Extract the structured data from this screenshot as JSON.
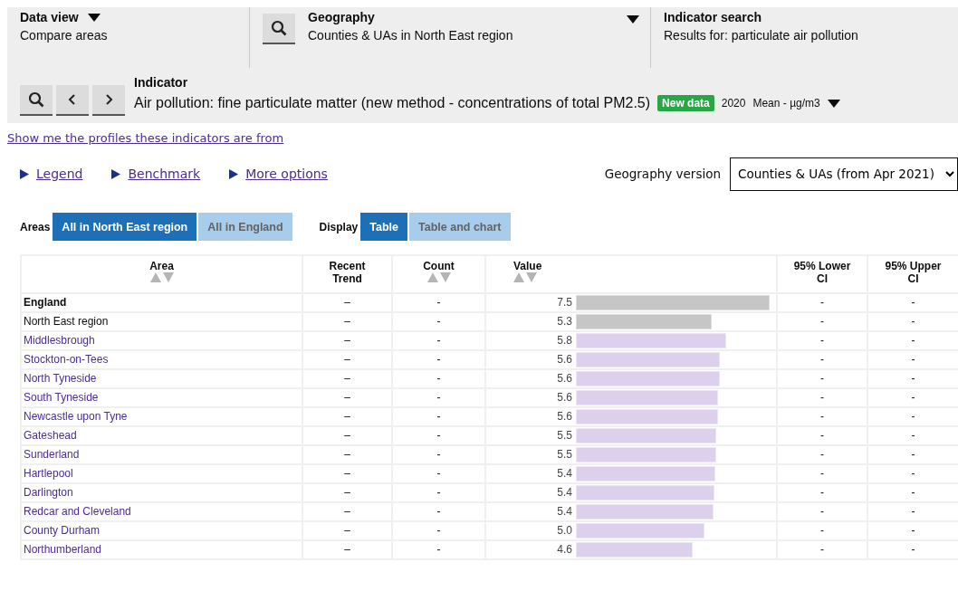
{
  "header": {
    "data_view": {
      "label": "Data view",
      "value": "Compare areas"
    },
    "geography": {
      "label": "Geography",
      "value": "Counties & UAs in North East region"
    },
    "indicator_search": {
      "label": "Indicator search",
      "value": "Results for: particulate air pollution"
    },
    "indicator": {
      "label": "Indicator",
      "name": "Air pollution: fine particulate matter (new method - concentrations of total PM2.5)",
      "badge": "New data",
      "period": "2020",
      "unit": "Mean - µg/m3"
    }
  },
  "profiles_link": "Show me the profiles these indicators are from",
  "toggles": [
    "Legend",
    "Benchmark",
    "More options"
  ],
  "geography_version": {
    "label": "Geography version",
    "value": "Counties & UAs (from Apr 2021)"
  },
  "areas": {
    "label": "Areas",
    "options": [
      {
        "label": "All in North East region",
        "selected": true
      },
      {
        "label": "All in England",
        "selected": false
      }
    ]
  },
  "display": {
    "label": "Display",
    "options": [
      {
        "label": "Table",
        "selected": true
      },
      {
        "label": "Table and chart",
        "selected": false
      }
    ]
  },
  "table": {
    "columns": [
      {
        "label": "Area",
        "sortable": true
      },
      {
        "label": "Recent Trend",
        "sortable": false
      },
      {
        "label": "Count",
        "sortable": true
      },
      {
        "label": "Value",
        "sortable": true
      },
      {
        "label": "95% Lower CI",
        "sortable": false
      },
      {
        "label": "95% Upper CI",
        "sortable": false
      }
    ],
    "rows": [
      {
        "kind": "national",
        "area": "England",
        "trend": "–",
        "count": "-",
        "value": "7.5",
        "level": 0.98,
        "lower": "-",
        "upper": "-"
      },
      {
        "kind": "region",
        "area": "North East region",
        "trend": "–",
        "count": "-",
        "value": "5.3",
        "level": 0.69,
        "lower": "-",
        "upper": "-"
      },
      {
        "kind": "area",
        "area": "Middlesbrough",
        "trend": "–",
        "count": "-",
        "value": "5.8",
        "level": 0.76,
        "lower": "-",
        "upper": "-"
      },
      {
        "kind": "area",
        "area": "Stockton-on-Tees",
        "trend": "–",
        "count": "-",
        "value": "5.6",
        "level": 0.73,
        "lower": "-",
        "upper": "-"
      },
      {
        "kind": "area",
        "area": "North Tyneside",
        "trend": "–",
        "count": "-",
        "value": "5.6",
        "level": 0.73,
        "lower": "-",
        "upper": "-"
      },
      {
        "kind": "area",
        "area": "South Tyneside",
        "trend": "–",
        "count": "-",
        "value": "5.6",
        "level": 0.72,
        "lower": "-",
        "upper": "-"
      },
      {
        "kind": "area",
        "area": "Newcastle upon Tyne",
        "trend": "–",
        "count": "-",
        "value": "5.6",
        "level": 0.72,
        "lower": "-",
        "upper": "-"
      },
      {
        "kind": "area",
        "area": "Gateshead",
        "trend": "–",
        "count": "-",
        "value": "5.5",
        "level": 0.71,
        "lower": "-",
        "upper": "-"
      },
      {
        "kind": "area",
        "area": "Sunderland",
        "trend": "–",
        "count": "-",
        "value": "5.5",
        "level": 0.71,
        "lower": "-",
        "upper": "-"
      },
      {
        "kind": "area",
        "area": "Hartlepool",
        "trend": "–",
        "count": "-",
        "value": "5.4",
        "level": 0.705,
        "lower": "-",
        "upper": "-"
      },
      {
        "kind": "area",
        "area": "Darlington",
        "trend": "–",
        "count": "-",
        "value": "5.4",
        "level": 0.7,
        "lower": "-",
        "upper": "-"
      },
      {
        "kind": "area",
        "area": "Redcar and Cleveland",
        "trend": "–",
        "count": "-",
        "value": "5.4",
        "level": 0.695,
        "lower": "-",
        "upper": "-"
      },
      {
        "kind": "area",
        "area": "County Durham",
        "trend": "–",
        "count": "-",
        "value": "5.0",
        "level": 0.65,
        "lower": "-",
        "upper": "-"
      },
      {
        "kind": "area",
        "area": "Northumberland",
        "trend": "–",
        "count": "-",
        "value": "4.6",
        "level": 0.59,
        "lower": "-",
        "upper": "-"
      }
    ]
  }
}
